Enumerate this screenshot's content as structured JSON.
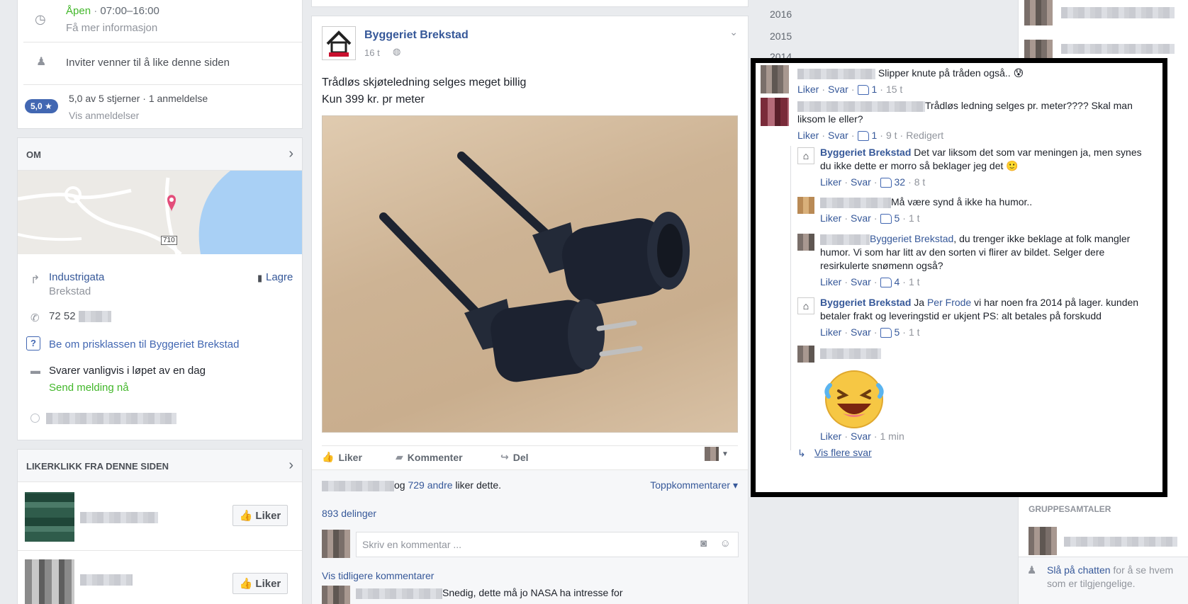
{
  "left": {
    "hours_status": "Åpen",
    "hours_sep": " · ",
    "hours_time": "07:00–16:00",
    "more_info": "Få mer informasjon",
    "invite": "Inviter venner til å like denne siden",
    "rating_badge": "5,0 ★",
    "rating_text": "5,0 av 5 stjerner · 1 anmeldelse",
    "see_reviews": "Vis anmeldelser",
    "about_header": "OM",
    "map_road": "710",
    "address_street": "Industrigata",
    "address_city": "Brekstad",
    "save": "Lagre",
    "phone": "72 52",
    "price_link": "Be om prisklassen til Byggeriet Brekstad",
    "respond_text": "Svarer vanligvis i løpet av en dag",
    "send_message": "Send melding nå",
    "likes_header": "LIKERKLIKK FRA DENNE SIDEN",
    "like_label": "Liker"
  },
  "post": {
    "page_name": "Byggeriet Brekstad",
    "time": "16 t",
    "text_line1": "Trådløs skjøteledning selges meget billig",
    "text_line2": "Kun 399 kr. pr meter",
    "action_like": "Liker",
    "action_comment": "Kommenter",
    "action_share": "Del",
    "likes_mid": "og ",
    "likes_link": "729 andre",
    "likes_tail": " liker dette.",
    "top_comments": "Toppkommentarer ▾",
    "shares": "893 delinger",
    "comment_placeholder": "Skriv en kommentar ...",
    "prev_comments": "Vis tidligere kommentarer",
    "last_comment": "Snedig, dette må jo NASA ha intresse for"
  },
  "years": [
    "2016",
    "2015",
    "2014"
  ],
  "comments": [
    {
      "text": "Slipper knute på tråden også.. 😰",
      "like": "Liker",
      "reply": "Svar",
      "count": "1",
      "time": "15 t"
    },
    {
      "text": "Trådløs ledning selges pr. meter???? Skal man liksom le eller?",
      "like": "Liker",
      "reply": "Svar",
      "count": "1",
      "time": "9 t",
      "edited": "Redigert"
    }
  ],
  "replies": [
    {
      "author": "Byggeriet Brekstad",
      "text": "Det var liksom det som var meningen ja, men synes du ikke dette er morro så beklager jeg det 🙂",
      "count": "32",
      "time": "8 t"
    },
    {
      "text": "Må være synd å ikke ha humor..",
      "count": "5",
      "time": "1 t"
    },
    {
      "mention": "Byggeriet Brekstad",
      "text": ", du trenger ikke beklage at folk mangler humor. Vi som har litt av den sorten vi flirer av bildet. Selger dere resirkulerte snømenn også?",
      "count": "4",
      "time": "1 t"
    },
    {
      "author": "Byggeriet Brekstad",
      "pre": "Ja ",
      "mention": "Per Frode",
      "text": " vi har noen fra 2014 på lager. kunden betaler frakt og leveringstid er ukjent PS: alt betales på forskudd",
      "count": "5",
      "time": "1 t"
    },
    {
      "time": "1 min"
    }
  ],
  "reply_like": "Liker",
  "reply_reply": "Svar",
  "more_replies": "Vis flere svar",
  "sidebar": {
    "group_header": "GRUPPESAMTALER",
    "chat_link": "Slå på chatten",
    "chat_text": " for å se hvem som er tilgjengelige."
  },
  "colors": {
    "accent": "#4267b2",
    "link": "#365899",
    "green": "#42b72a",
    "bg": "#e9ebee"
  }
}
